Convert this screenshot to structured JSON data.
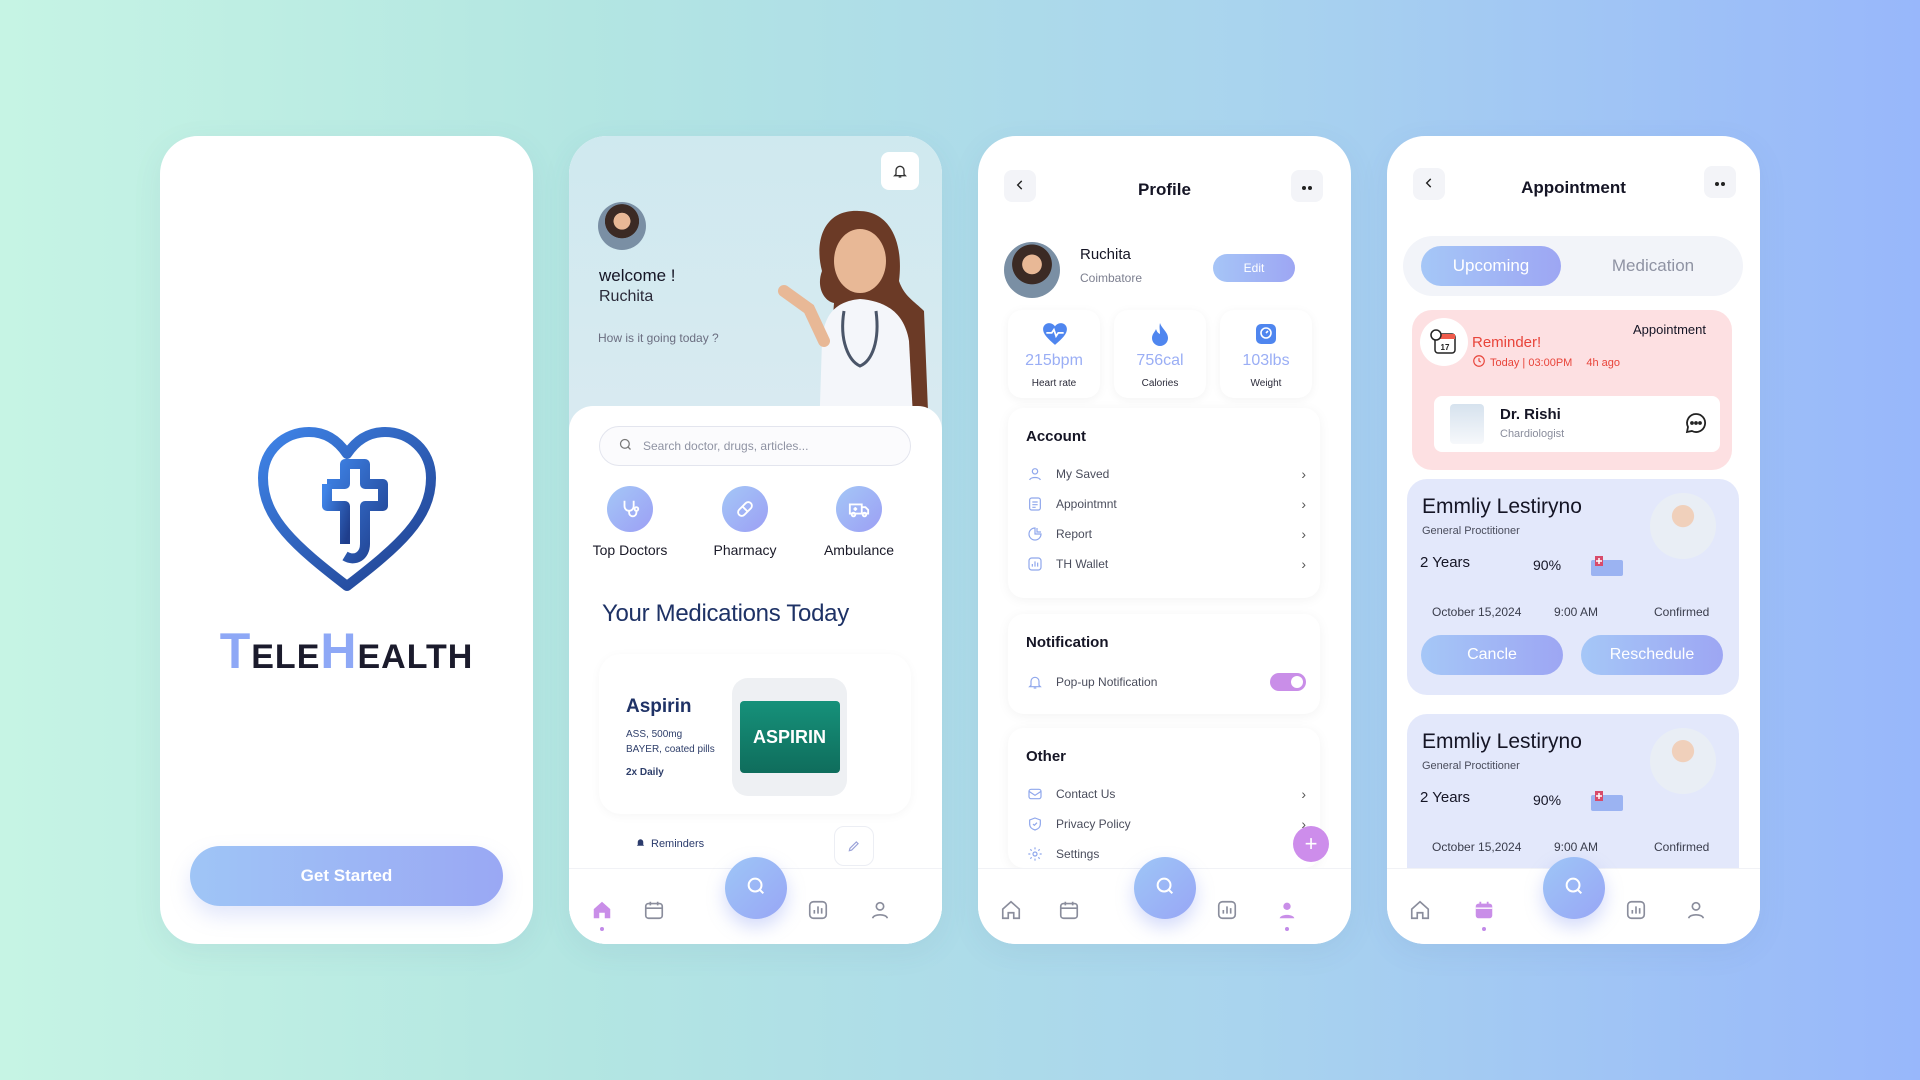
{
  "splash": {
    "brand_t": "T",
    "brand_ele": "ELE",
    "brand_h": "H",
    "brand_ealth": "EALTH",
    "cta": "Get Started"
  },
  "home": {
    "welcome": "welcome !",
    "user": "Ruchita",
    "subtitle": "How is it going today ?",
    "search_placeholder": "Search doctor, drugs, articles...",
    "categories": [
      "Top Doctors",
      "Pharmacy",
      "Ambulance"
    ],
    "section_title": "Your Medications Today",
    "med": {
      "name": "Aspirin",
      "line1": "ASS, 500mg",
      "line2": "BAYER, coated pills",
      "dose": "2x Daily",
      "pack_label": "ASPIRIN",
      "reminders": "Reminders"
    }
  },
  "profile": {
    "title": "Profile",
    "name": "Ruchita",
    "city": "Coimbatore",
    "edit": "Edit",
    "stats": [
      {
        "value": "215bpm",
        "label": "Heart rate",
        "icon": "heart-pulse-icon"
      },
      {
        "value": "756cal",
        "label": "Calories",
        "icon": "flame-icon"
      },
      {
        "value": "103lbs",
        "label": "Weight",
        "icon": "scale-icon"
      }
    ],
    "account_title": "Account",
    "account_items": [
      "My Saved",
      "Appointmnt",
      "Report",
      "TH Wallet"
    ],
    "notification_title": "Notification",
    "notification_item": "Pop-up Notification",
    "other_title": "Other",
    "other_items": [
      "Contact Us",
      "Privacy Policy",
      "Settings"
    ]
  },
  "appointment": {
    "title": "Appointment",
    "tab_on": "Upcoming",
    "tab_off": "Medication",
    "reminder": {
      "label": "Appointment",
      "title": "Reminder!",
      "date_num": "17",
      "time": "Today | 03:00PM",
      "ago": "4h ago",
      "doctor": "Dr. Rishi",
      "specialty": "Chardiologist"
    },
    "cards": [
      {
        "name": "Emmliy Lestiryno",
        "spec": "General Proctitioner",
        "years": "2 Years",
        "percent": "90%",
        "date": "October 15,2024",
        "time": "9:00 AM",
        "status": "Confirmed",
        "cancel": "Cancle",
        "reschedule": "Reschedule"
      },
      {
        "name": "Emmliy Lestiryno",
        "spec": "General Proctitioner",
        "years": "2 Years",
        "percent": "90%",
        "date": "October 15,2024",
        "time": "9:00 AM",
        "status": "Confirmed"
      }
    ]
  },
  "colors": {
    "accent": "#9da6f3",
    "accent_light": "#a5c7f7",
    "pink": "#c98ee8",
    "reminder_bg": "#fde0e2",
    "navy": "#1e3266"
  }
}
